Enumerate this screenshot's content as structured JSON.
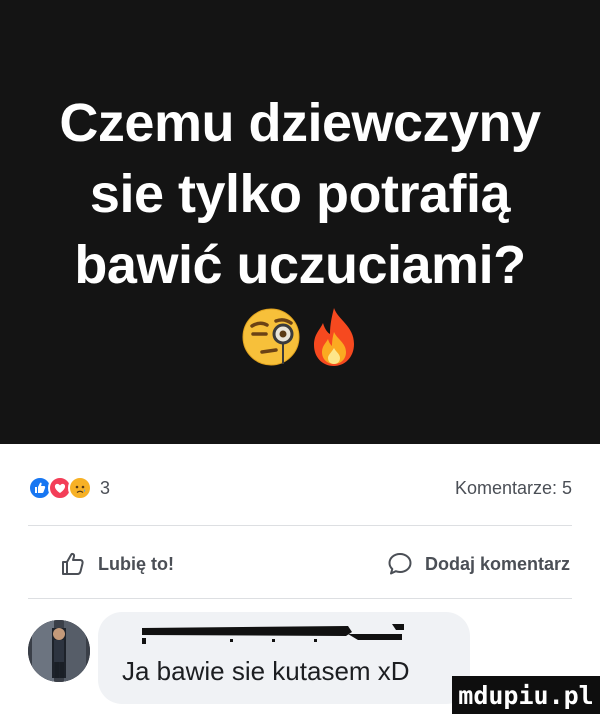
{
  "post": {
    "title_lines": [
      "Czemu dziewczyny",
      "sie tylko potrafią",
      "bawić uczuciami?"
    ],
    "emojis": [
      "face-with-monocle-icon",
      "fire-icon"
    ]
  },
  "reactions": {
    "icons": [
      "like-reaction-icon",
      "love-reaction-icon",
      "sad-reaction-icon"
    ],
    "count": "3",
    "comments_label": "Komentarze: 5"
  },
  "actions": {
    "like_label": "Lubię to!",
    "comment_label": "Dodaj komentarz"
  },
  "comment": {
    "text": "Ja bawie sie kutasem xD"
  },
  "watermark": {
    "text": "mdupiu.pl"
  },
  "colors": {
    "hero_bg": "#141414",
    "like_blue": "#1877f2",
    "love_red": "#f33e58",
    "sad_yellow": "#f7b125",
    "redaction": "#111111"
  }
}
